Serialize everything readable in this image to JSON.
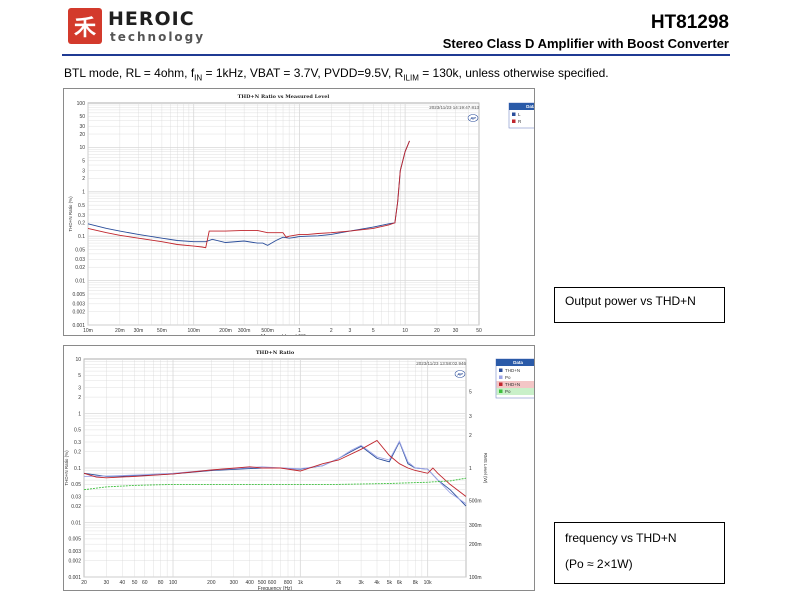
{
  "header": {
    "logo_mark": "禾",
    "logo_word1": "HEROIC",
    "logo_word2": "technology",
    "part_number": "HT81298",
    "subtitle": "Stereo Class D Amplifier with Boost Converter"
  },
  "conditions": {
    "p1": "BTL mode, RL = 4ohm, f",
    "s1": "IN",
    "p2": " = 1kHz, VBAT = 3.7V, PVDD=9.5V, R",
    "s2": "ILIM",
    "p3": " = 130k, unless otherwise specified."
  },
  "captions": {
    "top": "Output power vs THD+N",
    "bottom_line1": "frequency vs THD+N",
    "bottom_line2": "(Po ≈ 2×1W)"
  },
  "colors": {
    "blue": "#2a4d9a",
    "red": "#c0262d",
    "lightblue": "#9ea6e8",
    "green": "#3dbf3d",
    "grid": "#d8d8d8"
  },
  "chart_data": [
    {
      "type": "line",
      "title": "THD+N Ratio vs Measured Level",
      "timestamp": "2023/11/23 14:19:47.813",
      "xlabel": "Measured Level (W)",
      "ylabel": "THD+N Ratio (%)",
      "xscale": "log",
      "yscale": "log",
      "xlim": [
        0.01,
        50
      ],
      "ylim": [
        0.001,
        100
      ],
      "x_ticks": [
        "10m",
        "20m",
        "30m",
        "50m",
        "100m",
        "200m",
        "300m",
        "500m",
        "1",
        "2",
        "3",
        "5",
        "10",
        "20",
        "30",
        "50"
      ],
      "y_ticks": [
        "100",
        "50",
        "30",
        "20",
        "10",
        "5",
        "3",
        "2",
        "1",
        "0.5",
        "0.3",
        "0.2",
        "0.1",
        "0.05",
        "0.03",
        "0.02",
        "0.01",
        "0.005",
        "0.003",
        "0.002",
        "0.001"
      ],
      "legend_title": "Data",
      "legend_position": "top-right",
      "series": [
        {
          "name": "L",
          "color": "#2a4d9a",
          "x": [
            0.01,
            0.015,
            0.02,
            0.03,
            0.05,
            0.07,
            0.1,
            0.13,
            0.15,
            0.2,
            0.3,
            0.4,
            0.45,
            0.5,
            0.6,
            0.7,
            0.8,
            0.9,
            1.0,
            1.2,
            1.5,
            2,
            3,
            5,
            7,
            8,
            8.5,
            9,
            10,
            11
          ],
          "y": [
            0.19,
            0.15,
            0.13,
            0.11,
            0.09,
            0.08,
            0.075,
            0.075,
            0.085,
            0.072,
            0.078,
            0.07,
            0.07,
            0.062,
            0.08,
            0.095,
            0.09,
            0.094,
            0.098,
            0.1,
            0.102,
            0.11,
            0.13,
            0.16,
            0.19,
            0.2,
            0.6,
            3,
            8,
            14
          ]
        },
        {
          "name": "R",
          "color": "#c0262d",
          "x": [
            0.01,
            0.015,
            0.02,
            0.03,
            0.05,
            0.07,
            0.1,
            0.12,
            0.13,
            0.14,
            0.2,
            0.3,
            0.4,
            0.5,
            0.7,
            0.75,
            0.8,
            1.0,
            1.2,
            1.5,
            2,
            3,
            5,
            7,
            8,
            8.5,
            9,
            10,
            11
          ],
          "y": [
            0.15,
            0.12,
            0.105,
            0.09,
            0.075,
            0.065,
            0.06,
            0.057,
            0.055,
            0.13,
            0.13,
            0.135,
            0.135,
            0.12,
            0.12,
            0.095,
            0.1,
            0.11,
            0.11,
            0.115,
            0.12,
            0.13,
            0.15,
            0.18,
            0.2,
            0.6,
            3,
            8,
            14
          ]
        }
      ]
    },
    {
      "type": "line",
      "title": "THD+N Ratio",
      "timestamp": "2023/11/23 13:58:02.946",
      "xlabel": "Frequency (Hz)",
      "ylabel": "THD+N Ratio (%)",
      "y2label": "RMS Level (W)",
      "xscale": "log",
      "yscale": "log",
      "xlim": [
        20,
        20000
      ],
      "ylim": [
        0.001,
        10
      ],
      "x_ticks": [
        "20",
        "30",
        "40",
        "50",
        "60",
        "80",
        "100",
        "200",
        "300",
        "400",
        "500",
        "600",
        "800",
        "1k",
        "2k",
        "3k",
        "4k",
        "5k",
        "6k",
        "8k",
        "10k"
      ],
      "y_ticks": [
        "10",
        "5",
        "3",
        "2",
        "1",
        "0.5",
        "0.3",
        "0.2",
        "0.1",
        "0.05",
        "0.03",
        "0.02",
        "0.01",
        "0.005",
        "0.003",
        "0.002",
        "0.001"
      ],
      "y2_ticks": [
        "5",
        "3",
        "2",
        "1",
        "500m",
        "300m",
        "200m",
        "100m"
      ],
      "legend_title": "Data",
      "legend_position": "top-right",
      "series": [
        {
          "name": "THD+N",
          "color": "#2a4d9a",
          "x": [
            20,
            30,
            50,
            100,
            200,
            500,
            700,
            1000,
            1500,
            2000,
            2500,
            3000,
            4000,
            5000,
            6000,
            7000,
            8000,
            10000,
            12000,
            15000,
            20000
          ],
          "y": [
            0.08,
            0.07,
            0.072,
            0.078,
            0.09,
            0.1,
            0.1,
            0.095,
            0.11,
            0.15,
            0.2,
            0.25,
            0.15,
            0.13,
            0.3,
            0.12,
            0.1,
            0.095,
            0.06,
            0.04,
            0.02
          ]
        },
        {
          "name": "Po",
          "color": "#9ea6e8",
          "x": [
            20,
            30,
            50,
            100,
            200,
            500,
            700,
            1000,
            1500,
            2000,
            2500,
            3000,
            4000,
            5000,
            6000,
            7000,
            8000,
            10000,
            12000,
            15000,
            20000
          ],
          "y": [
            0.07,
            0.071,
            0.074,
            0.08,
            0.092,
            0.105,
            0.1,
            0.097,
            0.11,
            0.15,
            0.21,
            0.26,
            0.16,
            0.14,
            0.31,
            0.13,
            0.1,
            0.095,
            0.06,
            0.035,
            0.022
          ]
        },
        {
          "name": "THD+N",
          "color": "#c0262d",
          "x": [
            20,
            25,
            30,
            50,
            100,
            200,
            400,
            500,
            700,
            1000,
            1500,
            2000,
            3000,
            4000,
            5000,
            6000,
            7000,
            8000,
            10000,
            11000,
            12000,
            15000,
            20000
          ],
          "y": [
            0.08,
            0.068,
            0.066,
            0.07,
            0.078,
            0.092,
            0.105,
            0.1,
            0.1,
            0.088,
            0.12,
            0.14,
            0.22,
            0.32,
            0.17,
            0.12,
            0.1,
            0.09,
            0.08,
            0.1,
            0.08,
            0.05,
            0.03
          ]
        },
        {
          "name": "Po",
          "color": "#3dbf3d",
          "x": [
            20,
            30,
            50,
            100,
            200,
            500,
            1000,
            2000,
            5000,
            10000,
            15000,
            20000
          ],
          "y": [
            0.04,
            0.045,
            0.048,
            0.05,
            0.05,
            0.05,
            0.05,
            0.05,
            0.052,
            0.055,
            0.058,
            0.065
          ]
        }
      ]
    }
  ]
}
